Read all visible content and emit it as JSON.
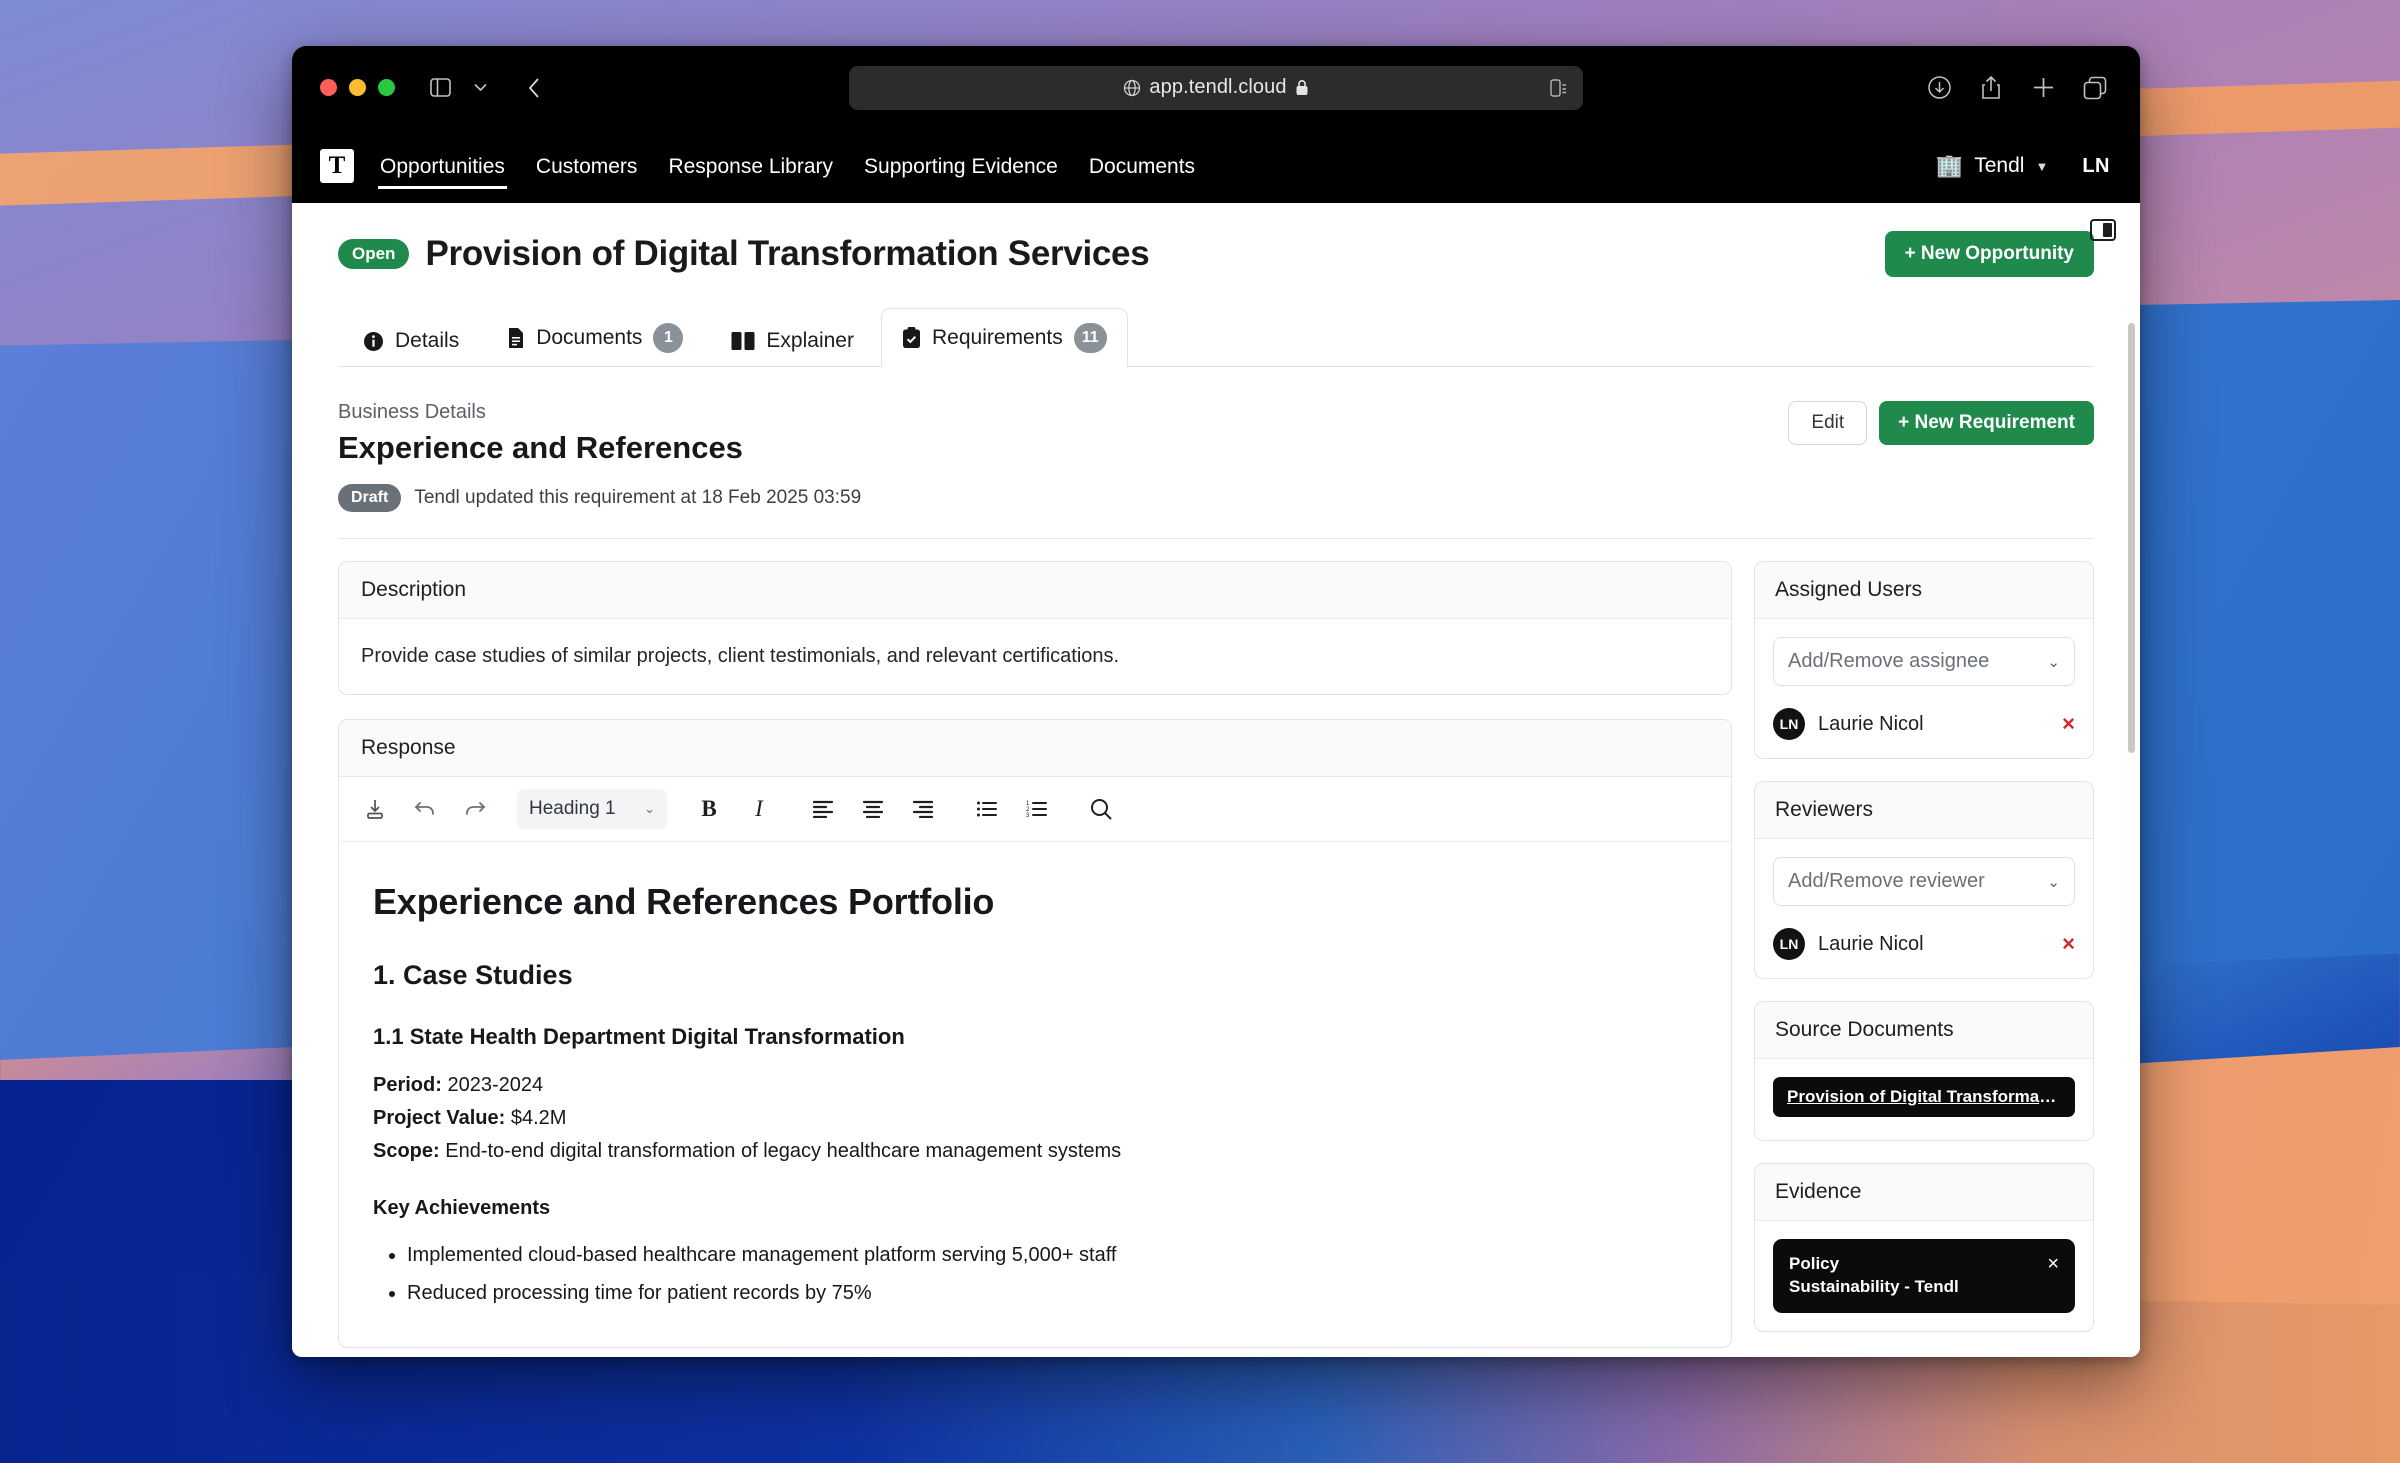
{
  "browser": {
    "url": "app.tendl.cloud",
    "lock_icon": "lock-icon",
    "globe_icon": "globe-icon",
    "toolbar_icons": [
      "sidebar-icon",
      "chevron-down-icon",
      "back-icon",
      "download-icon",
      "share-icon",
      "new-tab-icon",
      "tab-overview-icon"
    ],
    "reader_icon": "reader-view-icon"
  },
  "appnav": {
    "logo": "T",
    "links": [
      {
        "label": "Opportunities",
        "active": true
      },
      {
        "label": "Customers",
        "active": false
      },
      {
        "label": "Response Library",
        "active": false
      },
      {
        "label": "Supporting Evidence",
        "active": false
      },
      {
        "label": "Documents",
        "active": false
      }
    ],
    "org_name": "Tendl",
    "org_icon": "office-building-icon",
    "user_initials": "LN"
  },
  "header": {
    "status_badge": "Open",
    "title": "Provision of Digital Transformation Services",
    "new_opportunity_label": "+ New Opportunity",
    "panel_toggle_icon": "right-panel-toggle-icon"
  },
  "tabs": [
    {
      "label": "Details",
      "icon": "info-icon",
      "badge": "",
      "active": false
    },
    {
      "label": "Documents",
      "icon": "document-icon",
      "badge": "1",
      "active": false
    },
    {
      "label": "Explainer",
      "icon": "book-icon",
      "badge": "",
      "active": false
    },
    {
      "label": "Requirements",
      "icon": "clipboard-check-icon",
      "badge": "11",
      "active": true
    }
  ],
  "requirement": {
    "eyebrow": "Business Details",
    "title": "Experience and References",
    "draft_badge": "Draft",
    "updated_text": "Tendl updated this requirement at 18 Feb 2025 03:59",
    "edit_label": "Edit",
    "new_requirement_label": "+ New Requirement"
  },
  "description": {
    "header": "Description",
    "body": "Provide case studies of similar projects, client testimonials, and relevant certifications."
  },
  "response": {
    "header": "Response",
    "toolbar": {
      "save_icon": "save-icon",
      "undo_icon": "undo-icon",
      "redo_icon": "redo-icon",
      "style_value": "Heading 1",
      "bold_label": "B",
      "italic_label": "I",
      "align_left_icon": "align-left-icon",
      "align_center_icon": "align-center-icon",
      "align_right_icon": "align-right-icon",
      "bullet_list_icon": "bullet-list-icon",
      "numbered_list_icon": "numbered-list-icon",
      "search_icon": "search-icon"
    },
    "document": {
      "h1": "Experience and References Portfolio",
      "h2": "1. Case Studies",
      "h3": "1.1 State Health Department Digital Transformation",
      "fields": [
        {
          "label": "Period:",
          "value": "2023-2024"
        },
        {
          "label": "Project Value:",
          "value": "$4.2M"
        },
        {
          "label": "Scope:",
          "value": "End-to-end digital transformation of legacy healthcare management systems"
        }
      ],
      "achievements_heading": "Key Achievements",
      "achievements": [
        "Implemented cloud-based healthcare management platform serving 5,000+ staff",
        "Reduced processing time for patient records by 75%"
      ]
    }
  },
  "sidebar": {
    "assigned_users": {
      "header": "Assigned Users",
      "select_placeholder": "Add/Remove assignee",
      "people": [
        {
          "initials": "LN",
          "name": "Laurie Nicol",
          "remove": "×"
        }
      ]
    },
    "reviewers": {
      "header": "Reviewers",
      "select_placeholder": "Add/Remove reviewer",
      "people": [
        {
          "initials": "LN",
          "name": "Laurie Nicol",
          "remove": "×"
        }
      ]
    },
    "source_documents": {
      "header": "Source Documents",
      "items": [
        "Provision of Digital Transformati..."
      ]
    },
    "evidence": {
      "header": "Evidence",
      "items": [
        {
          "line1": "Policy",
          "line2": "Sustainability - Tendl",
          "close": "×"
        }
      ]
    }
  },
  "colors": {
    "brand_green": "#1f8a4c",
    "nav_black": "#000000",
    "draft_grey": "#6a7078",
    "remove_red": "#d02b2b"
  }
}
